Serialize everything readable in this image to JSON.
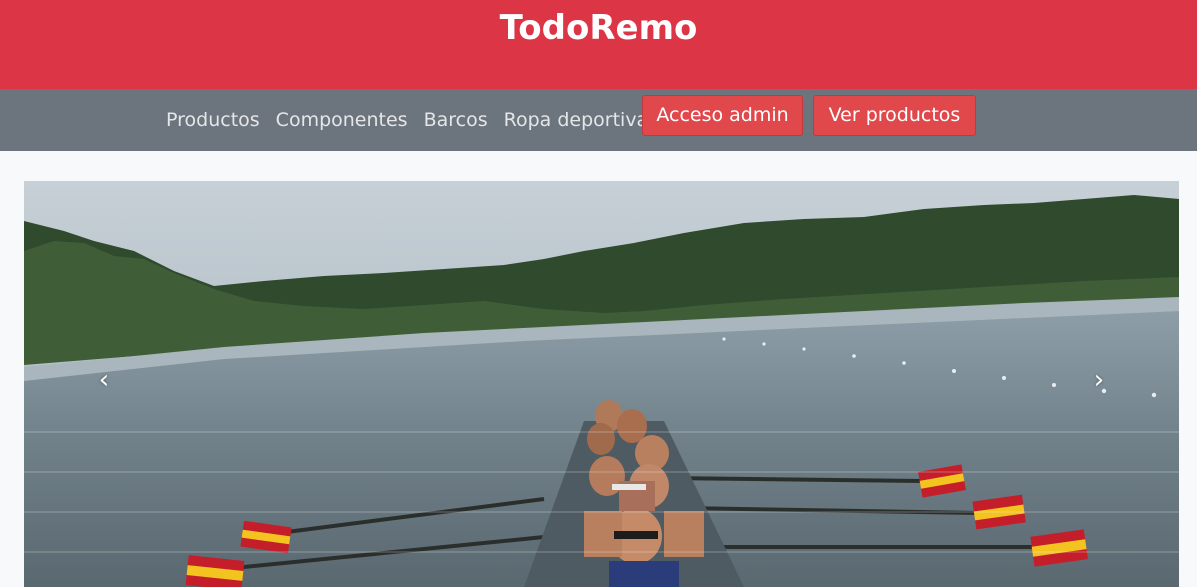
{
  "header": {
    "brand": "TodoRemo",
    "color": "#dc3545"
  },
  "nav": {
    "links": [
      "Productos",
      "Componentes",
      "Barcos",
      "Ropa deportiva"
    ],
    "admin_button": "Acceso admin",
    "products_button": "Ver productos",
    "color": "#6c757d"
  },
  "carousel": {
    "prev_icon": "‹",
    "next_icon": "›",
    "image": "rowing-eight-on-lake-photo"
  }
}
